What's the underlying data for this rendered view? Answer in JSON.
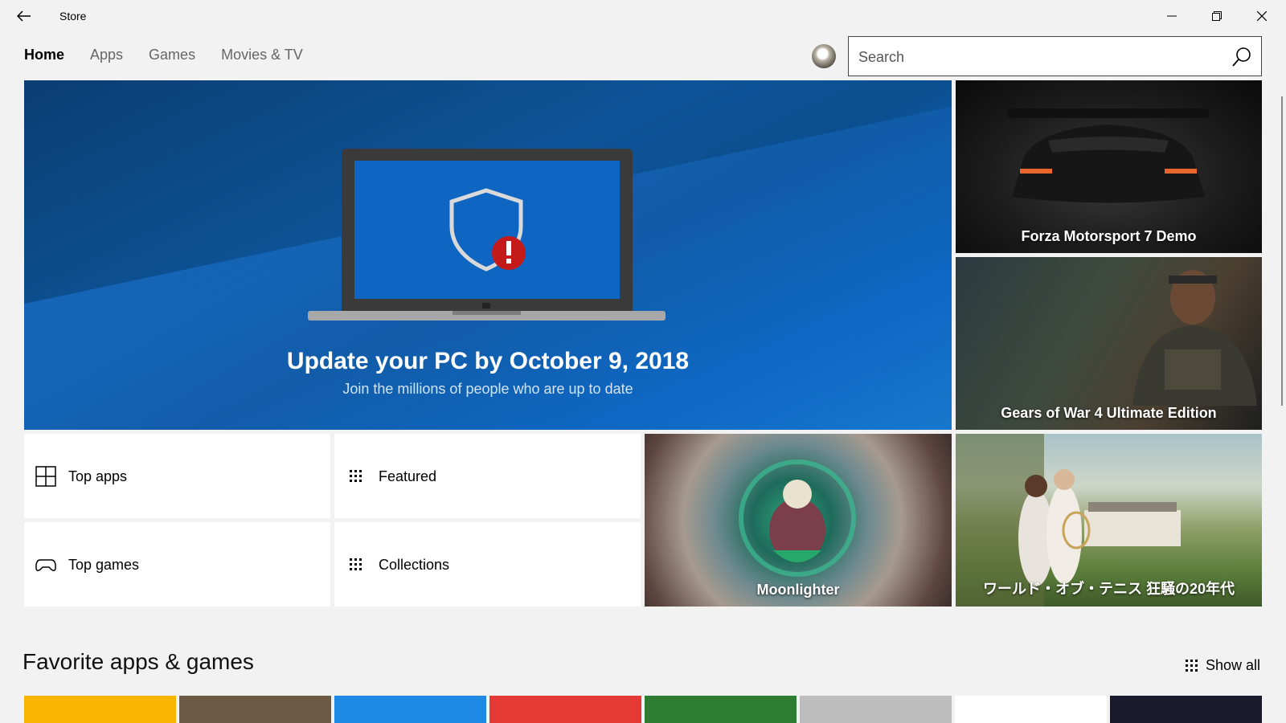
{
  "window": {
    "title": "Store"
  },
  "nav": {
    "items": [
      {
        "label": "Home",
        "active": true
      },
      {
        "label": "Apps",
        "active": false
      },
      {
        "label": "Games",
        "active": false
      },
      {
        "label": "Movies & TV",
        "active": false
      }
    ]
  },
  "search": {
    "placeholder": "Search",
    "value": ""
  },
  "hero": {
    "title": "Update your PC by October 9, 2018",
    "subtitle": "Join the millions of people who are up to date"
  },
  "tiles": {
    "forza": "Forza Motorsport 7 Demo",
    "gears": "Gears of War 4 Ultimate Edition",
    "moonlighter": "Moonlighter",
    "tennis": "ワールド・オブ・テニス 狂騒の20年代"
  },
  "categories": [
    {
      "label": "Top apps",
      "icon": "top-apps-icon"
    },
    {
      "label": "Featured",
      "icon": "grid-dots-icon"
    },
    {
      "label": "Top games",
      "icon": "gamepad-icon"
    },
    {
      "label": "Collections",
      "icon": "grid-dots-icon"
    }
  ],
  "section": {
    "title": "Favorite apps & games",
    "show_all": "Show all"
  },
  "thumb_colors": [
    "#f7b500",
    "#6d5a45",
    "#1e88e5",
    "#e53935",
    "#2e7d32",
    "#bdbdbd",
    "#ffffff",
    "#1a1a2e"
  ]
}
